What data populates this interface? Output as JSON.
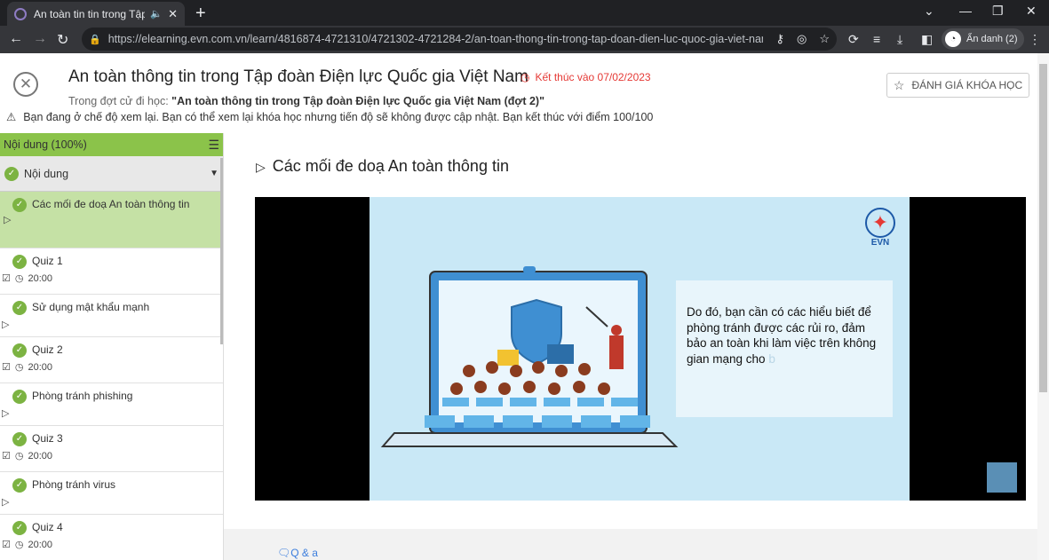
{
  "browser": {
    "tab_title": "An toàn tin tin trong Tập",
    "url": "https://elearning.evn.com.vn/learn/4816874-4721310/4721302-4721284-2/an-toan-thong-tin-trong-tap-doan-dien-luc-quoc-gia-viet-nam....",
    "profile_label": "Ẩn danh (2)"
  },
  "header": {
    "course_title": "An toàn thông tin trong Tập đoàn Điện lực Quốc gia Việt Nam",
    "end_date": "Kết thúc vào 07/02/2023",
    "round_prefix": "Trong đợt cử đi học: ",
    "round_name": "\"An toàn thông tin trong Tập đoàn Điện lực Quốc gia Việt Nam (đợt 2)\"",
    "rate_button": "ĐÁNH GIÁ KHÓA HỌC",
    "review_notice": "Bạn đang ở chế độ xem lại. Bạn có thể xem lại khóa học nhưng tiến độ sẽ không được cập nhật. Bạn kết thúc với điểm 100/100"
  },
  "sidebar": {
    "header": "Nội dung (100%)",
    "section": "Nội dung",
    "items": [
      {
        "name": "Các mối đe doạ An toàn thông tin",
        "meta": ""
      },
      {
        "name": "Quiz 1",
        "meta": "20:00"
      },
      {
        "name": "Sử dụng mật khẩu mạnh",
        "meta": ""
      },
      {
        "name": "Quiz 2",
        "meta": "20:00"
      },
      {
        "name": "Phòng tránh phishing",
        "meta": ""
      },
      {
        "name": "Quiz 3",
        "meta": "20:00"
      },
      {
        "name": "Phòng tránh virus",
        "meta": ""
      },
      {
        "name": "Quiz 4",
        "meta": "20:00"
      }
    ]
  },
  "main": {
    "lesson_title": "Các mối đe doạ An toàn thông tin",
    "slide_logo": "EVN",
    "slide_text": "Do đó, bạn cần có các hiểu biết để phòng tránh được các rủi ro, đảm bảo an toàn khi làm việc trên không gian mạng cho ",
    "slide_text_fade": "b",
    "qa_label": "Q & a"
  }
}
